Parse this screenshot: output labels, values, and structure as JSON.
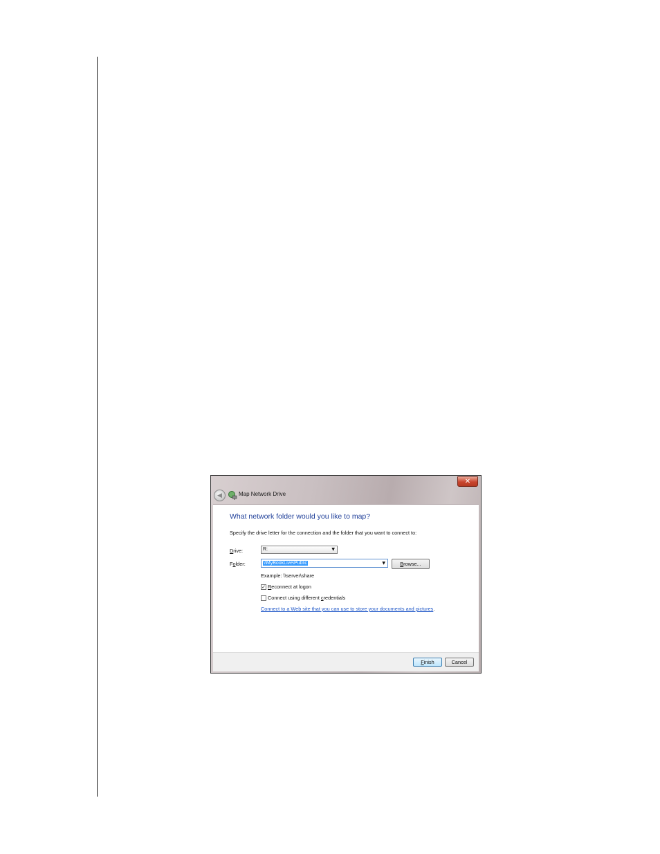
{
  "dialog": {
    "title": "Map Network Drive",
    "close_glyph": "✕",
    "back_glyph": "◀",
    "heading": "What network folder would you like to map?",
    "description": "Specify the drive letter for the connection and the folder that you want to connect to:",
    "drive": {
      "label_key": "D",
      "label_rest": "rive:",
      "value": "R:"
    },
    "folder": {
      "label_pre": "F",
      "label_key": "o",
      "label_rest": "lder:",
      "value": "\\\\MyBookLive\\Public",
      "browse_key": "B",
      "browse_rest": "rowse..."
    },
    "example": "Example: \\\\server\\share",
    "reconnect": {
      "checked": true,
      "label_key": "R",
      "label_rest": "econnect at logon"
    },
    "credentials": {
      "checked": false,
      "label_pre": "Connect using different ",
      "label_key": "c",
      "label_rest": "redentials"
    },
    "link": "Connect to a Web site that you can use to store your documents and pictures",
    "link_suffix": ".",
    "finish": {
      "label_key": "F",
      "label_rest": "inish"
    },
    "cancel": "Cancel",
    "check_glyph": "✓",
    "caret_glyph": "▼"
  },
  "colors": {
    "heading": "#1f3f99",
    "link": "#2058c8",
    "selection": "#3399ff"
  }
}
